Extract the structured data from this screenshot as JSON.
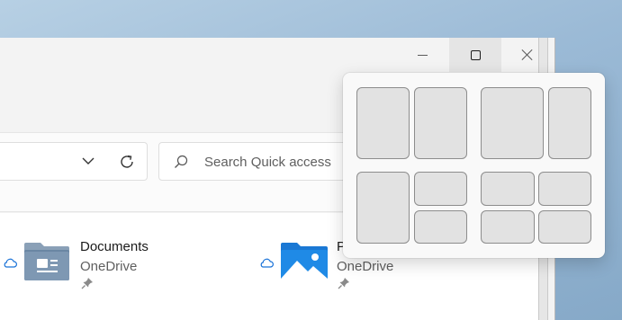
{
  "window": {
    "caption": {
      "minimize_icon": "minimize-icon",
      "maximize_icon": "maximize-icon",
      "close_icon": "close-icon"
    }
  },
  "toolbar": {
    "search_placeholder": "Search Quick access",
    "chevron_icon": "chevron-down-icon",
    "refresh_icon": "refresh-icon",
    "search_icon": "search-icon"
  },
  "items": [
    {
      "title": "Documents",
      "subtitle": "OneDrive",
      "icon": "documents-folder-icon",
      "status_icon": "cloud-icon",
      "pin_icon": "pin-icon"
    },
    {
      "title": "P",
      "subtitle": "OneDrive",
      "icon": "pictures-folder-icon",
      "status_icon": "cloud-icon",
      "pin_icon": "pin-icon"
    }
  ],
  "snap_layouts": {
    "layouts": [
      "two-equal-columns",
      "wide-left-narrow-right",
      "left-column-right-stack",
      "four-quadrants"
    ]
  }
}
